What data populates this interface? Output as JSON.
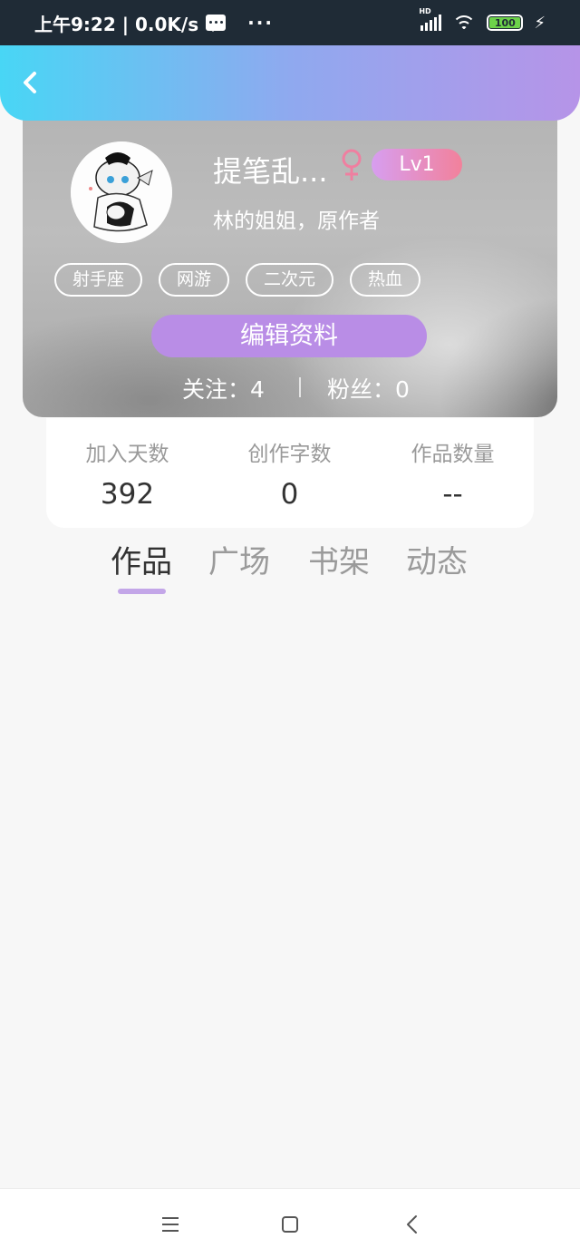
{
  "status_bar": {
    "time_speed": "上午9:22 | 0.0K/s",
    "more": "···",
    "network_label": "HD",
    "battery": "100"
  },
  "profile": {
    "nickname": "提笔乱...",
    "level": "Lv1",
    "signature": "林的姐姐，原作者",
    "tags": [
      "射手座",
      "网游",
      "二次元",
      "热血"
    ],
    "edit_button": "编辑资料",
    "following": "关注：4",
    "followers": "粉丝：0"
  },
  "stats": [
    {
      "label": "加入天数",
      "value": "392"
    },
    {
      "label": "创作字数",
      "value": "0"
    },
    {
      "label": "作品数量",
      "value": "--"
    }
  ],
  "tabs": [
    {
      "label": "作品",
      "active": true
    },
    {
      "label": "广场",
      "active": false
    },
    {
      "label": "书架",
      "active": false
    },
    {
      "label": "动态",
      "active": false
    }
  ],
  "colors": {
    "header_gradient_start": "#48d6f5",
    "header_gradient_end": "#b694e8",
    "edit_button": "#b98de6",
    "level_badge_start": "#d79ef0",
    "level_badge_end": "#f2819b",
    "gender_female": "#ef7fa0",
    "tab_indicator": "#c3a6e8"
  },
  "icons": {
    "back": "chevron-left-icon",
    "gender": "female-icon",
    "nav_menu": "menu-icon",
    "nav_home": "square-home-icon",
    "nav_back": "chevron-left-icon"
  }
}
